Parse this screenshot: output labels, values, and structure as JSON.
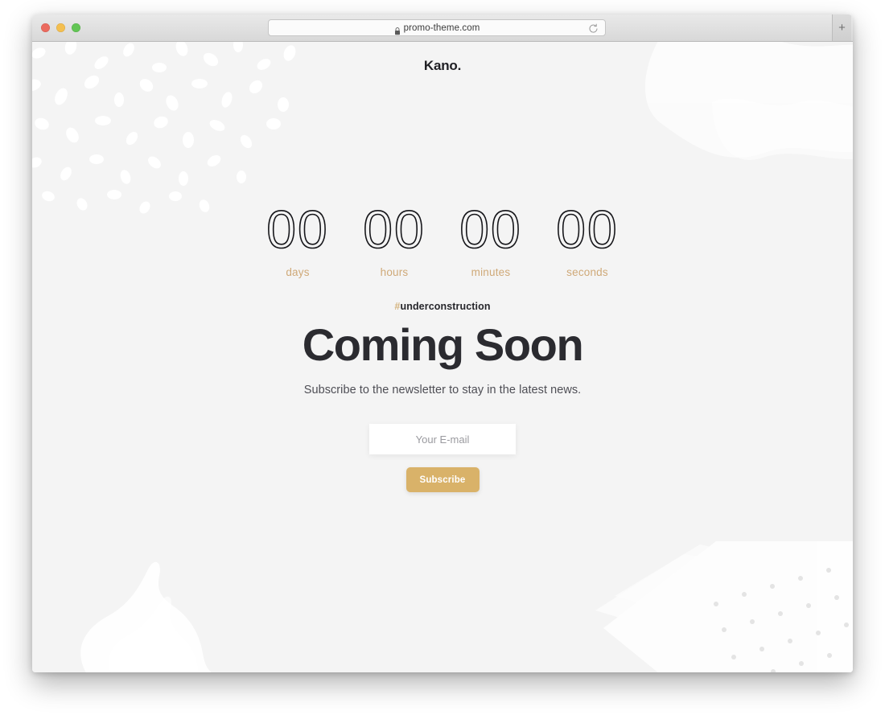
{
  "browser": {
    "url": "promo-theme.com",
    "lock_icon": "lock-icon",
    "reload_icon": "reload-icon",
    "new_tab_label": "+",
    "traffic_lights": [
      "close",
      "minimize",
      "zoom"
    ]
  },
  "site": {
    "logo": "Kano.",
    "background_color": "#f4f4f4",
    "accent_color": "#d9b269",
    "label_color": "#cfa978",
    "heading_color": "#2b2b30"
  },
  "countdown": {
    "units": [
      {
        "value": "00",
        "label": "days"
      },
      {
        "value": "00",
        "label": "hours"
      },
      {
        "value": "00",
        "label": "minutes"
      },
      {
        "value": "00",
        "label": "seconds"
      }
    ]
  },
  "hero": {
    "hashtag_symbol": "#",
    "hashtag_text": "underconstruction",
    "heading": "Coming Soon",
    "subtitle": "Subscribe to the newsletter to stay in the latest news."
  },
  "form": {
    "email_placeholder": "Your E-mail",
    "email_value": "",
    "submit_label": "Subscribe"
  },
  "decorations": [
    "speckle-cluster-top-left",
    "paint-blob-top-right",
    "paint-stroke-bottom-left",
    "diagonal-brush-dots-bottom-right"
  ]
}
